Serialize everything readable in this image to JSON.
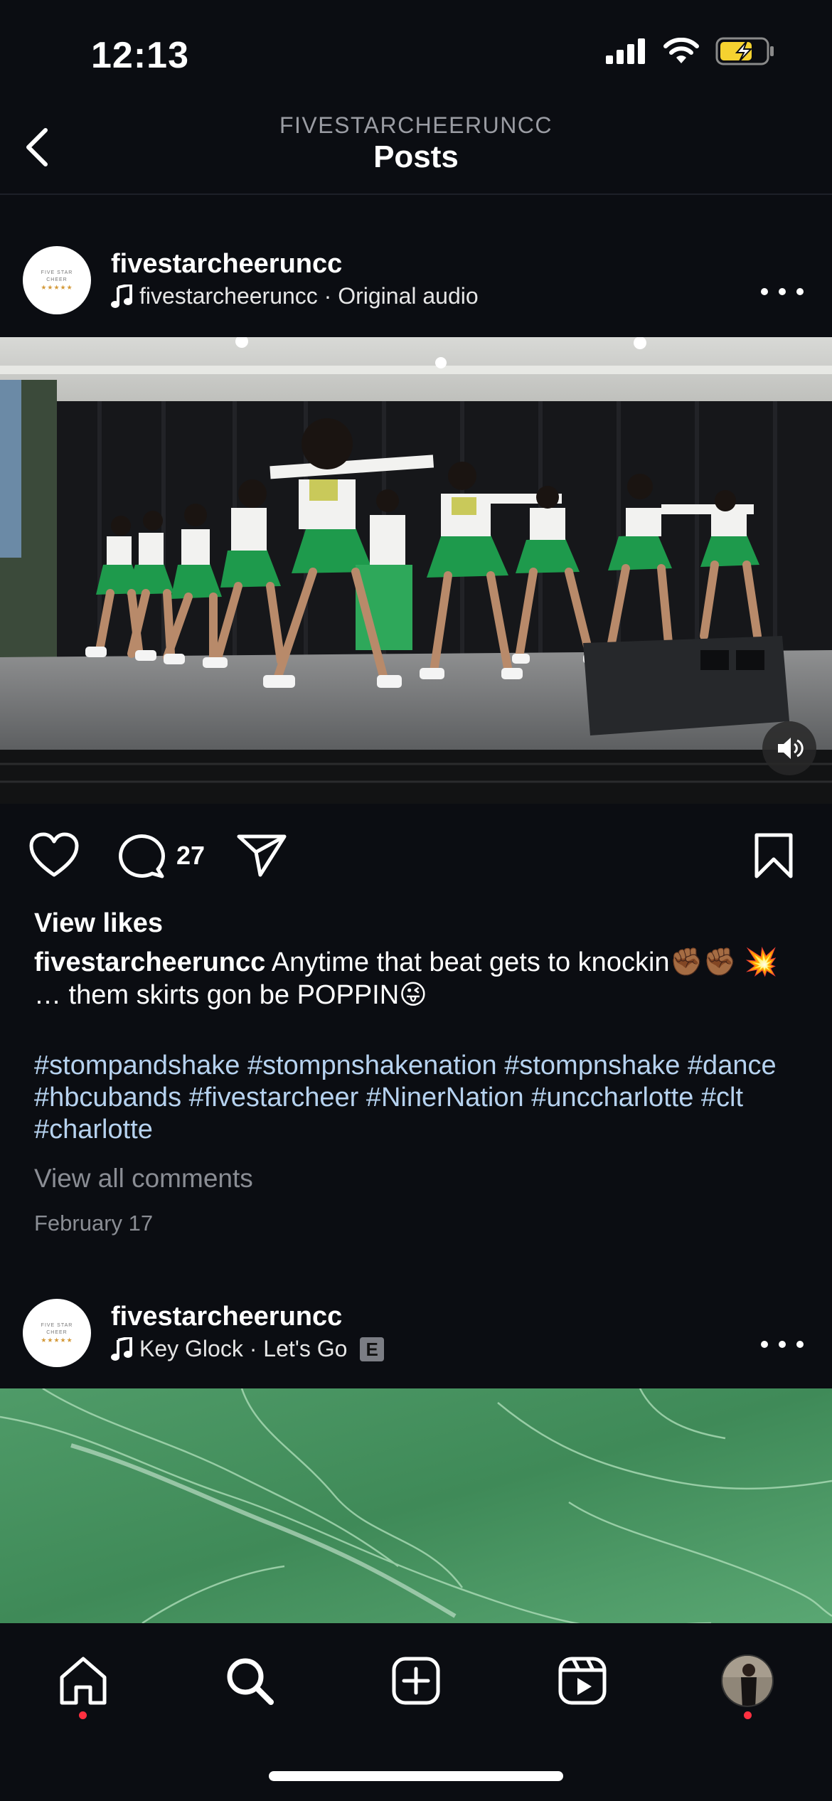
{
  "status_bar": {
    "time": "12:13"
  },
  "header": {
    "subtitle": "FIVESTARCHEERUNCC",
    "title": "Posts"
  },
  "post1": {
    "username": "fivestarcheeruncc",
    "audio": "fivestarcheeruncc · Original audio",
    "comment_count": "27",
    "view_likes": "View likes",
    "caption_user": "fivestarcheeruncc",
    "caption_text": "Anytime that beat gets to knockin✊🏾✊🏾 💥 … them skirts gon be POPPIN😜",
    "hashtags": "#stompandshake #stompnshakenation #stompnshake #dance #hbcubands #fivestarcheer #NinerNation #unccharlotte #clt #charlotte",
    "view_comments": "View all comments",
    "date": "February 17"
  },
  "post2": {
    "username": "fivestarcheeruncc",
    "audio": "Key Glock · Let's Go",
    "explicit": "E"
  },
  "avatar_logo": {
    "line1": "FIVE STAR",
    "line2": "CHEER",
    "stars": "★★★★★"
  },
  "colors": {
    "background": "#0b0d12",
    "hashtag": "#b6d2ef",
    "notification_dot": "#ff3040",
    "battery": "#f5d230"
  }
}
